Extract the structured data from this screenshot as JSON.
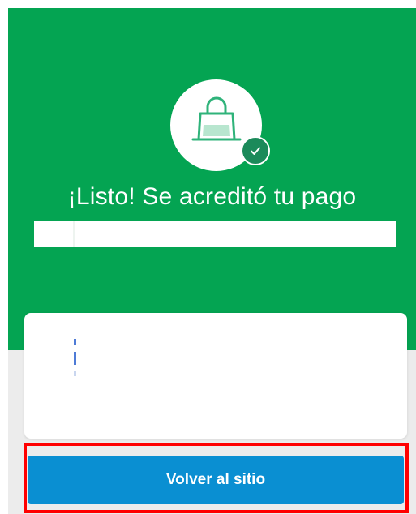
{
  "colors": {
    "hero_background": "#04a452",
    "lower_background": "#ececec",
    "primary_button": "#0a8fd2",
    "check_badge": "#1b8a5a",
    "icon_accent": "#2fb37a",
    "highlight": "#ff0000"
  },
  "status": {
    "icon": "shopping-bag-icon",
    "badge_icon": "check-icon",
    "title": "¡Listo! Se acreditó tu pago"
  },
  "actions": {
    "return_label": "Volver al sitio"
  }
}
